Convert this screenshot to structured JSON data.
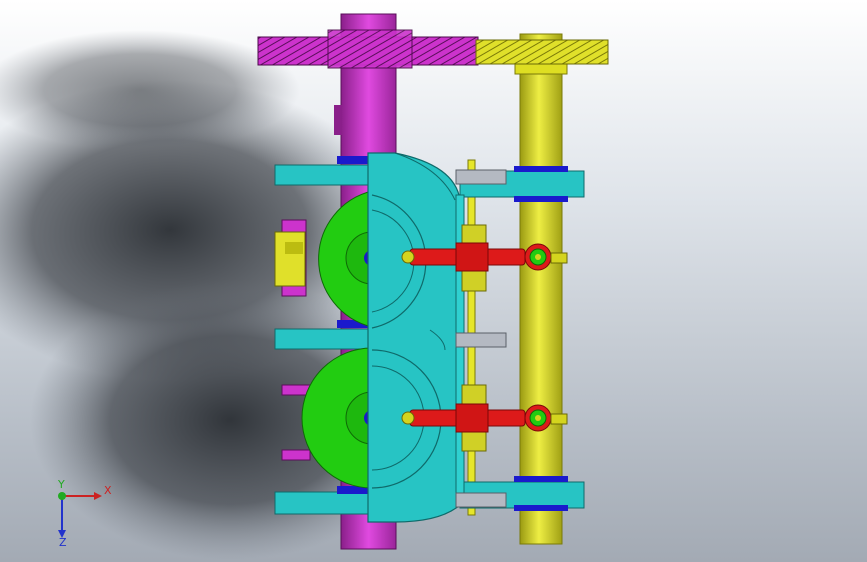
{
  "viewport": {
    "background_top": "#ffffff",
    "background_bottom": "#a3aab4"
  },
  "colors": {
    "magenta": "#cc33cc",
    "magenta_dark": "#8a1f8a",
    "yellow": "#d4d41e",
    "yellow_dark": "#8e8e10",
    "cyan": "#27c4c4",
    "cyan_dark": "#0f7a7a",
    "green": "#22cc11",
    "green_dark": "#128a08",
    "red": "#dd1a1a",
    "red_dark": "#8e0c0c",
    "blue": "#1a1acc",
    "gray": "#b4b9c2"
  },
  "triad": {
    "x_label": "X",
    "y_label": "Y",
    "z_label": "Z",
    "x_color": "#cc2222",
    "y_color": "#22aa22",
    "z_color": "#2233cc"
  }
}
